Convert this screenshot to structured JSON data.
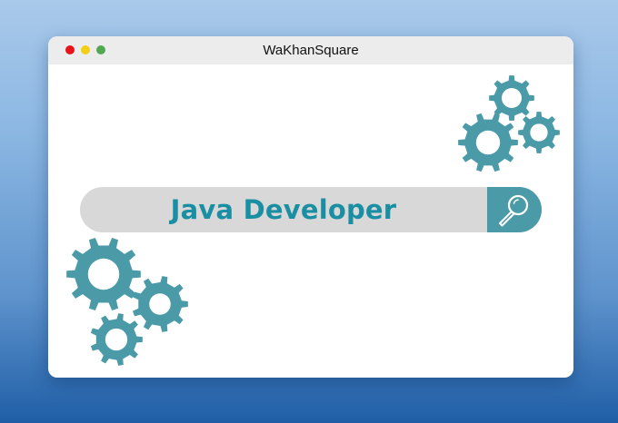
{
  "window": {
    "title": "WaKhanSquare",
    "controls": {
      "close_color": "#e8121b",
      "minimize_color": "#f2cf14",
      "zoom_color": "#52a852"
    }
  },
  "search": {
    "text": "Java Developer",
    "icon": "magnifier-icon"
  },
  "colors": {
    "accent": "#4a9aa8",
    "text_accent": "#1a8fa3",
    "search_bg": "#d8d8d8"
  },
  "decorations": {
    "icon": "gear-icon"
  }
}
